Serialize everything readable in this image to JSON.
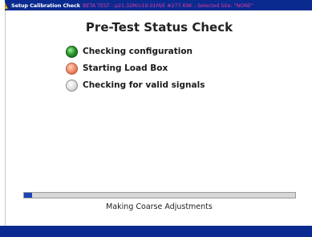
{
  "window": {
    "title": "Setup Calibration Check",
    "title_status": "BETA TEST - p21.32M/v19.01M/E #277.69K - Selected Site: \"NONE\"",
    "icon": "app-icon"
  },
  "page": {
    "title": "Pre-Test Status Check"
  },
  "checks": [
    {
      "label": "Checking configuration",
      "status": "complete",
      "color": "#2c9a2c",
      "icon": "status-dot"
    },
    {
      "label": "Starting Load Box",
      "status": "in-progress",
      "color": "#f59070",
      "icon": "status-dot"
    },
    {
      "label": "Checking for valid signals",
      "status": "pending",
      "color": "#e3e3e3",
      "icon": "status-dot"
    }
  ],
  "progress": {
    "fraction": 0.03,
    "message": "Making Coarse Adjustments"
  },
  "colors": {
    "titlebar": "#0a2a8f",
    "progress_fill": "#1d43b8",
    "title_status": "#d83aa0"
  }
}
